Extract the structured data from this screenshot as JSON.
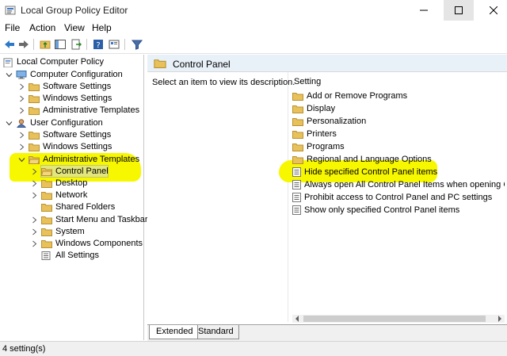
{
  "window": {
    "title": "Local Group Policy Editor"
  },
  "menu": [
    "File",
    "Action",
    "View",
    "Help"
  ],
  "tree": {
    "root": "Local Computer Policy",
    "computer_config": "Computer Configuration",
    "cc_children": [
      "Software Settings",
      "Windows Settings",
      "Administrative Templates"
    ],
    "user_config": "User Configuration",
    "uc_children": [
      "Software Settings",
      "Windows Settings"
    ],
    "uc_admin": "Administrative Templates",
    "uc_admin_children": [
      "Control Panel",
      "Desktop",
      "Network",
      "Shared Folders",
      "Start Menu and Taskbar",
      "System",
      "Windows Components",
      "All Settings"
    ]
  },
  "right": {
    "header": "Control Panel",
    "description": "Select an item to view its description.",
    "column": "Setting",
    "folders": [
      "Add or Remove Programs",
      "Display",
      "Personalization",
      "Printers",
      "Programs",
      "Regional and Language Options"
    ],
    "settings": [
      "Hide specified Control Panel items",
      "Always open All Control Panel Items when opening Control Panel",
      "Prohibit access to Control Panel and PC settings",
      "Show only specified Control Panel items"
    ]
  },
  "tabs": [
    "Extended",
    "Standard"
  ],
  "status": "4 setting(s)",
  "colors": {
    "highlight": "#f7f700",
    "folder": "#e8c15a",
    "header_bg": "#e8f0f8"
  }
}
